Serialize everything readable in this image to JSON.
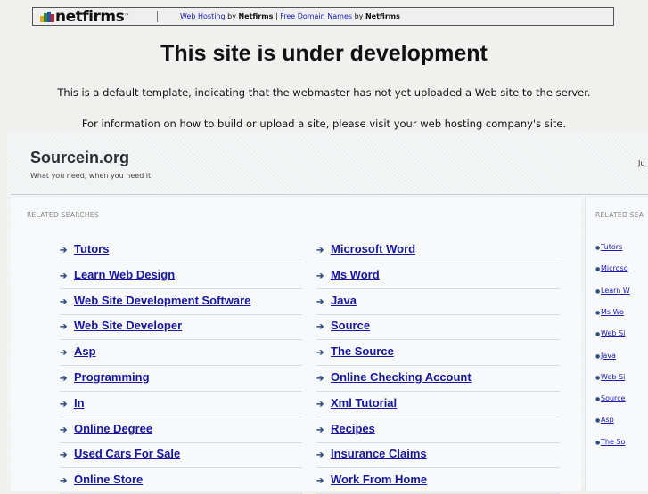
{
  "topbar": {
    "logo_text": "netfirms",
    "logo_tm": "™",
    "web_hosting_link": "Web Hosting",
    "by1": " by ",
    "netfirms1": "Netfirms",
    "divider": " | ",
    "domain_link": "Free Domain Names",
    "by2": " by ",
    "netfirms2": "Netfirms"
  },
  "headline": "This site is under development",
  "info_line1": "This is a default template, indicating that the webmaster has not yet uploaded a Web site to the server.",
  "info_line2": "For information on how to build or upload a site, please visit your web hosting company's site.",
  "site": {
    "title": "Sourcein.org",
    "tagline": "What you need, when you need it",
    "date_fragment": "Ju"
  },
  "related_title": "RELATED SEARCHES",
  "related_title_right": "RELATED SEA",
  "left_column": [
    "Tutors",
    "Learn Web Design",
    "Web Site Development Software",
    "Web Site Developer",
    "Asp",
    "Programming",
    "In",
    "Online Degree",
    "Used Cars For Sale",
    "Online Store"
  ],
  "right_column": [
    "Microsoft Word",
    "Ms Word",
    "Java",
    "Source",
    "The Source",
    "Online Checking Account",
    "Xml Tutorial",
    "Recipes",
    "Insurance Claims",
    "Work From Home"
  ],
  "sidebar_links": [
    "Tutors",
    "Microso",
    "Learn W",
    "Ms Wo",
    "Web Si",
    "Java",
    "Web Si",
    "Source",
    "Asp",
    "The So"
  ],
  "colors": {
    "link": "#17179e",
    "arrow": "#2f4f7f",
    "background": "#f0f0ee"
  }
}
